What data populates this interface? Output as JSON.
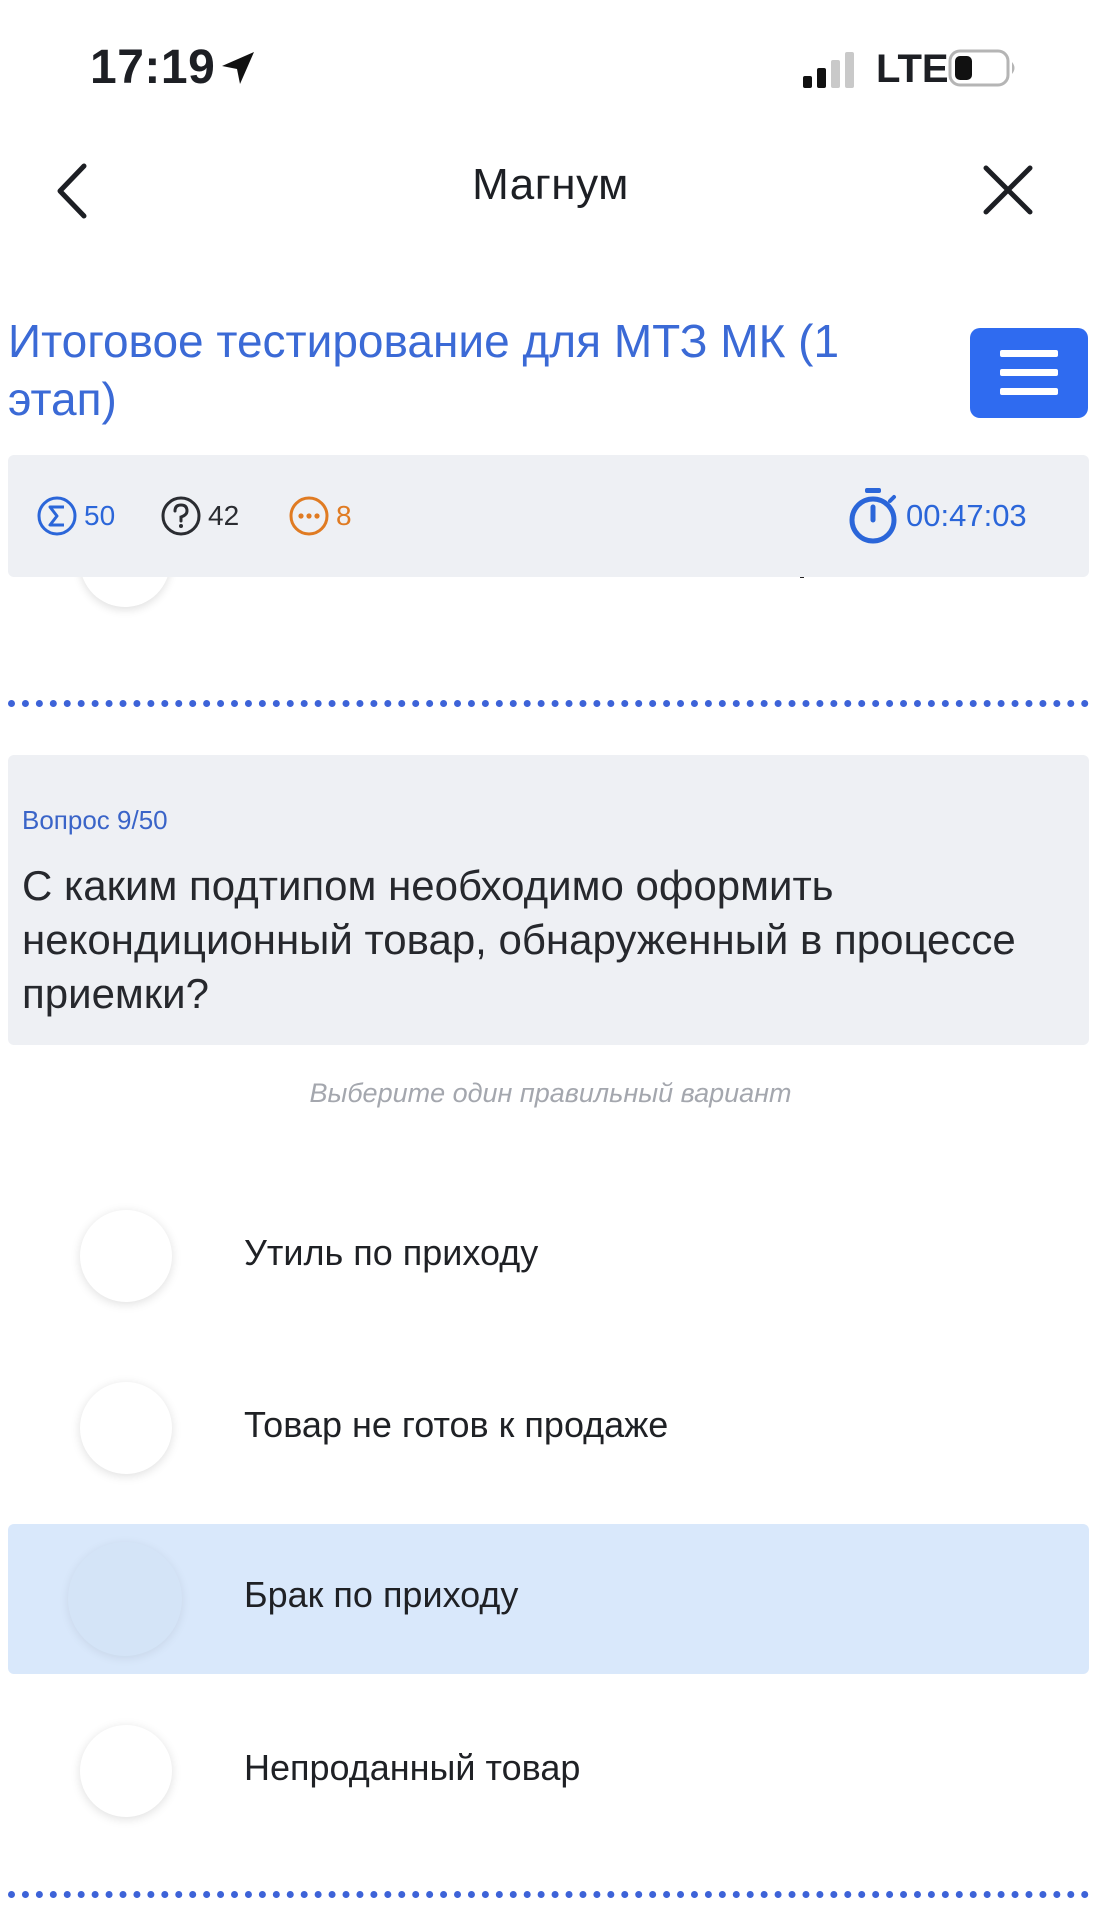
{
  "status_bar": {
    "time": "17:19",
    "network": "LTE",
    "location_icon": "location-arrow-icon",
    "signal_icon": "cell-signal-icon",
    "battery_icon": "battery-icon"
  },
  "nav": {
    "title": "Магнум",
    "back_icon": "chevron-left-icon",
    "close_icon": "close-icon"
  },
  "test": {
    "title": "Итоговое тестирование для МТЗ МК (1 этап)",
    "menu_icon": "hamburger-menu-icon"
  },
  "stats": {
    "total": "50",
    "remaining": "42",
    "skipped": "8",
    "timer": "00:47:03",
    "total_icon": "sigma-icon",
    "remaining_icon": "question-icon",
    "skipped_icon": "ellipsis-icon",
    "timer_icon": "stopwatch-icon"
  },
  "question": {
    "number": "Вопрос 9/50",
    "text": "С каким подтипом необходимо оформить некондиционный товар, обнаруженный в процессе приемки?",
    "hint": "Выберите один правильный вариант"
  },
  "answers": [
    {
      "label": "Утиль по приходу",
      "selected": false
    },
    {
      "label": "Товар не готов к продаже",
      "selected": false
    },
    {
      "label": "Брак по приходу",
      "selected": true
    },
    {
      "label": "Непроданный товар",
      "selected": false
    }
  ],
  "colors": {
    "accent": "#2f6bf0",
    "title_blue": "#3b6ad6",
    "skipped_orange": "#e07b22",
    "selected_bg": "#d9e8fb",
    "card_bg": "#eef0f4"
  }
}
